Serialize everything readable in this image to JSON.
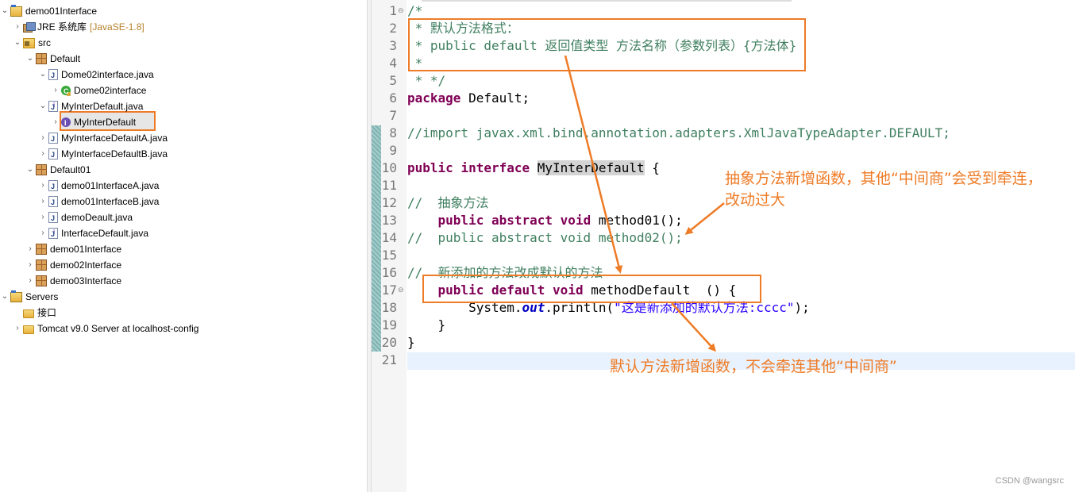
{
  "tree": {
    "items": [
      {
        "label": "demo01Interface",
        "icon": "project-folder-icon",
        "expanded": true
      },
      {
        "label": "JRE 系统库",
        "decoration": "[JavaSE-1.8]",
        "icon": "jre-library-icon",
        "expanded": false
      },
      {
        "label": "src",
        "icon": "source-folder-icon",
        "expanded": true
      },
      {
        "label": "Default",
        "icon": "package-icon",
        "expanded": true
      },
      {
        "label": "Dome02interface.java",
        "icon": "java-file-icon",
        "expanded": true
      },
      {
        "label": "Dome02interface",
        "icon": "class-icon",
        "expanded": false
      },
      {
        "label": "MyInterDefault.java",
        "icon": "java-file-icon",
        "expanded": true
      },
      {
        "label": "MyInterDefault",
        "icon": "interface-icon",
        "expanded": false,
        "selected": true
      },
      {
        "label": "MyInterfaceDefaultA.java",
        "icon": "java-file-icon",
        "expanded": false
      },
      {
        "label": "MyInterfaceDefaultB.java",
        "icon": "java-file-icon",
        "expanded": false
      },
      {
        "label": "Default01",
        "icon": "package-icon",
        "expanded": true
      },
      {
        "label": "demo01InterfaceA.java",
        "icon": "java-file-icon",
        "expanded": false
      },
      {
        "label": "demo01InterfaceB.java",
        "icon": "java-file-icon",
        "expanded": false
      },
      {
        "label": "demoDeault.java",
        "icon": "java-file-icon",
        "expanded": false
      },
      {
        "label": "InterfaceDefault.java",
        "icon": "java-file-icon",
        "expanded": false
      },
      {
        "label": "demo01Interface",
        "icon": "package-icon",
        "expanded": false
      },
      {
        "label": "demo02Interface",
        "icon": "package-icon",
        "expanded": false
      },
      {
        "label": "demo03Interface",
        "icon": "package-icon",
        "expanded": false
      },
      {
        "label": "Servers",
        "icon": "project-folder-icon",
        "expanded": true
      },
      {
        "label": "接口",
        "icon": "folder-icon",
        "expanded": null
      },
      {
        "label": "Tomcat v9.0 Server at localhost-config",
        "icon": "folder-icon",
        "expanded": false
      }
    ]
  },
  "editor": {
    "line_numbers": [
      "1",
      "2",
      "3",
      "4",
      "5",
      "6",
      "7",
      "8",
      "9",
      "10",
      "11",
      "12",
      "13",
      "14",
      "15",
      "16",
      "17",
      "18",
      "19",
      "20",
      "21"
    ],
    "lines": [
      [
        {
          "t": "/*",
          "c": "cm"
        }
      ],
      [
        {
          "t": " * 默认方法格式：",
          "c": "cm"
        }
      ],
      [
        {
          "t": " * public default 返回值类型 方法名称（参数列表）{方法体}",
          "c": "cm"
        }
      ],
      [
        {
          "t": " *",
          "c": "cm"
        }
      ],
      [
        {
          "t": " * */",
          "c": "cm"
        }
      ],
      [
        {
          "t": "package",
          "c": "kw"
        },
        {
          "t": " Default;",
          "c": ""
        }
      ],
      [],
      [
        {
          "t": "//import javax.xml.bind.annotation.adapters.XmlJavaTypeAdapter.DEFAULT;",
          "c": "cm"
        }
      ],
      [],
      [
        {
          "t": "public",
          "c": "kw"
        },
        {
          "t": " ",
          "c": ""
        },
        {
          "t": "interface",
          "c": "kw"
        },
        {
          "t": " ",
          "c": ""
        },
        {
          "t": "MyInterDefault",
          "c": "hl"
        },
        {
          "t": " {",
          "c": ""
        }
      ],
      [],
      [
        {
          "t": "//  抽象方法",
          "c": "cm"
        }
      ],
      [
        {
          "t": "    ",
          "c": ""
        },
        {
          "t": "public",
          "c": "kw"
        },
        {
          "t": " ",
          "c": ""
        },
        {
          "t": "abstract",
          "c": "kw"
        },
        {
          "t": " ",
          "c": ""
        },
        {
          "t": "void",
          "c": "kw"
        },
        {
          "t": " method01();",
          "c": ""
        }
      ],
      [
        {
          "t": "//  public abstract void method02();",
          "c": "cm"
        }
      ],
      [],
      [
        {
          "t": "//  新添加的方法改成默认的方法",
          "c": "cm"
        }
      ],
      [
        {
          "t": "    ",
          "c": ""
        },
        {
          "t": "public",
          "c": "kw"
        },
        {
          "t": " ",
          "c": ""
        },
        {
          "t": "default",
          "c": "kw"
        },
        {
          "t": " ",
          "c": ""
        },
        {
          "t": "void",
          "c": "kw"
        },
        {
          "t": " methodDefault  () {",
          "c": ""
        }
      ],
      [
        {
          "t": "        System.",
          "c": ""
        },
        {
          "t": "out",
          "c": "fld"
        },
        {
          "t": ".println(",
          "c": ""
        },
        {
          "t": "\"这是新添加的默认方法:cccc\"",
          "c": "st"
        },
        {
          "t": ");",
          "c": ""
        }
      ],
      [
        {
          "t": "    }",
          "c": ""
        }
      ],
      [
        {
          "t": "}",
          "c": ""
        }
      ],
      []
    ]
  },
  "annotations": {
    "note1": "抽象方法新增函数，其他“中间商”会受到牵连，",
    "note1b": "改动过大",
    "note2": "默认方法新增函数，不会牵连其他“中间商”",
    "color": "#ee7b26"
  },
  "watermark": "CSDN @wangsrc"
}
